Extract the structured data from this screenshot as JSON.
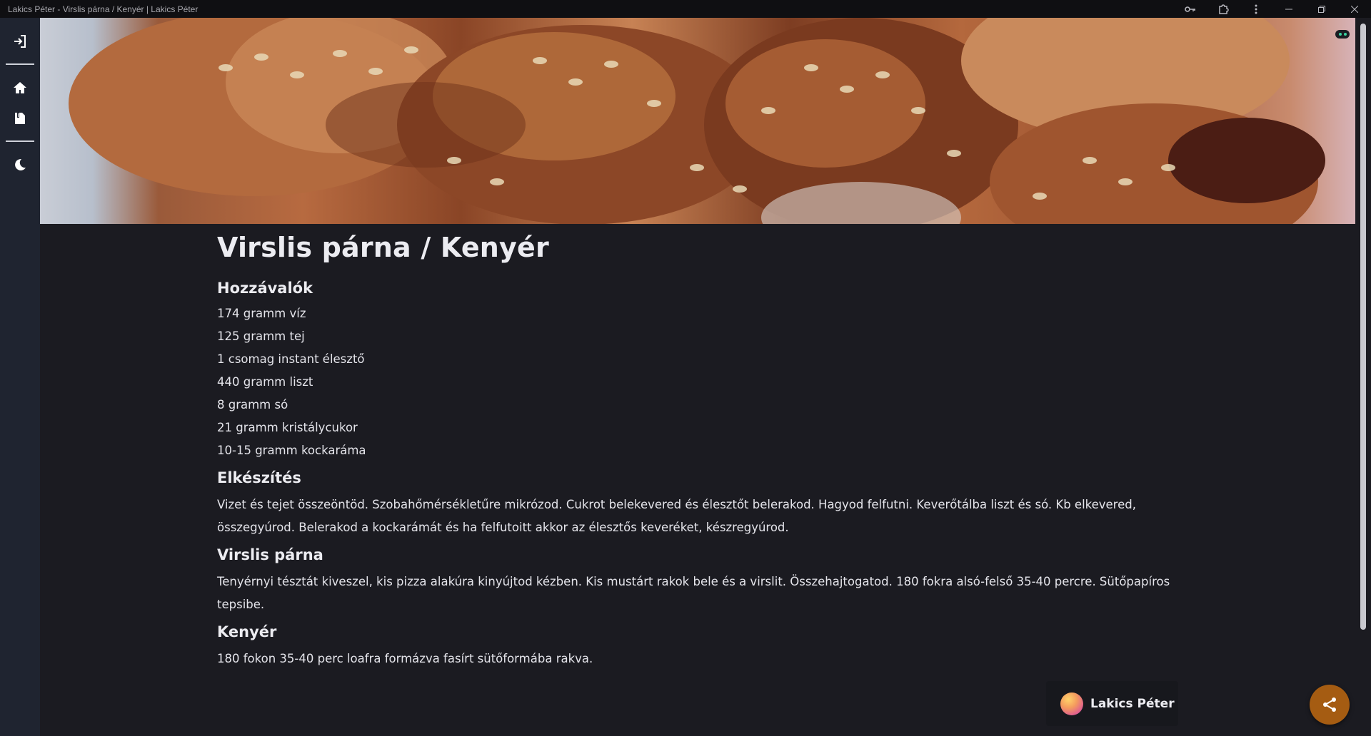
{
  "window": {
    "title": "Lakics Péter - Virslis párna / Kenyér | Lakics Péter"
  },
  "titlebar_icons": [
    "key-icon",
    "extensions-icon",
    "more-icon",
    "minimize-icon",
    "restore-icon",
    "close-icon"
  ],
  "sidenav": {
    "items": [
      "login-icon",
      "home-icon",
      "book-icon",
      "moon-icon"
    ]
  },
  "recipe": {
    "title": "Virslis párna / Kenyér",
    "ingredients_heading": "Hozzávalók",
    "ingredients": [
      "174 gramm víz",
      "125 gramm tej",
      "1 csomag instant élesztő",
      "440 gramm liszt",
      "8 gramm só",
      "21 gramm kristálycukor",
      "10-15 gramm kockaráma"
    ],
    "prep_heading": "Elkészítés",
    "prep_text": "Vizet és tejet összeöntöd. Szobahőmérsékletűre mikrózod. Cukrot belekevered és élesztőt belerakod. Hagyod felfutni. Keverőtálba liszt és só. Kb elkevered, összegyúrod. Belerakod a kockarámát és ha felfutoitt akkor az élesztős keveréket, készregyúrod.",
    "virslis_heading": "Virslis párna",
    "virslis_text": "Tenyérnyi tésztát kiveszel, kis pizza alakúra kinyújtod kézben. Kis mustárt rakok bele és a virslit. Összehajtogatod. 180 fokra alsó-felső 35-40 percre. Sütőpapíros tepsibe.",
    "kenyer_heading": "Kenyér",
    "kenyer_text": "180 fokon 35-40 perc loafra formázva fasírt sütőformába rakva."
  },
  "author": {
    "name": "Lakics Péter"
  },
  "colors": {
    "background": "#1b1b21",
    "sidenav": "#1f2430",
    "share_button": "#a55c12"
  }
}
